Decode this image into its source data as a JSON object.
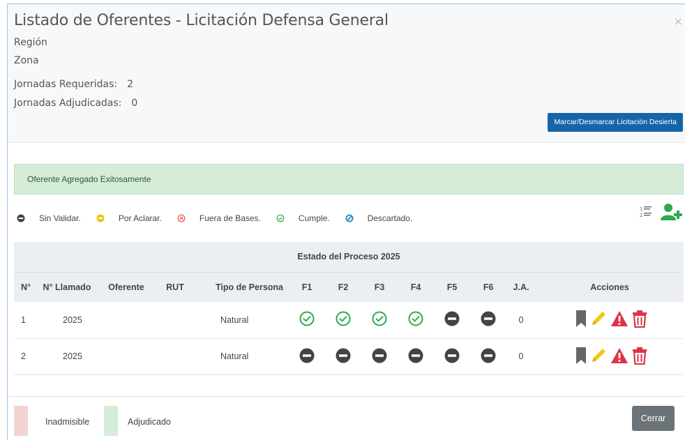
{
  "header": {
    "title": "Listado de Oferentes - Licitación Defensa General",
    "close_glyph": "×",
    "region_label": "Región",
    "zona_label": "Zona",
    "jornadas_requeridas_label": "Jornadas Requeridas:",
    "jornadas_requeridas_value": "2",
    "jornadas_adjudicadas_label": "Jornadas Adjudicadas:",
    "jornadas_adjudicadas_value": "0",
    "desierta_button": "Marcar/Desmarcar Licitación Desierta"
  },
  "alert": {
    "message": "Oferente Agregado Exitosamente"
  },
  "legend": [
    {
      "icon": "minus-circle-icon",
      "label": "Sin Validar.",
      "color": "#444444"
    },
    {
      "icon": "minus-circle-icon",
      "label": "Por Aclarar.",
      "color": "#f1c40f"
    },
    {
      "icon": "x-circle-icon",
      "label": "Fuera de Bases.",
      "color": "#e74c3c"
    },
    {
      "icon": "check-circle-icon",
      "label": "Cumple.",
      "color": "#2ea84b"
    },
    {
      "icon": "ban-icon",
      "label": "Descartado.",
      "color": "#1e88c8"
    }
  ],
  "table": {
    "group_header": "Estado del Proceso 2025",
    "columns": [
      "N°",
      "N° Llamado",
      "Oferente",
      "RUT",
      "Tipo de Persona",
      "F1",
      "F2",
      "F3",
      "F4",
      "F5",
      "F6",
      "J.A.",
      "Acciones"
    ],
    "rows": [
      {
        "n": "1",
        "llamado": "2025",
        "oferente": "",
        "rut": "",
        "tipo": "Natural",
        "f": [
          "check",
          "check",
          "check",
          "check",
          "minus",
          "minus"
        ],
        "ja": "0"
      },
      {
        "n": "2",
        "llamado": "2025",
        "oferente": "",
        "rut": "",
        "tipo": "Natural",
        "f": [
          "minus",
          "minus",
          "minus",
          "minus",
          "minus",
          "minus"
        ],
        "ja": "0"
      }
    ]
  },
  "footer": {
    "inadmisible_label": "Inadmisible",
    "adjudicado_label": "Adjudicado",
    "inadmisible_color": "#f4d3d3",
    "adjudicado_color": "#d5ecd8",
    "cerrar_button": "Cerrar"
  },
  "colors": {
    "primary_button": "#1565a8",
    "check": "#2ea84b",
    "minus": "#444444",
    "bookmark": "#666666",
    "pencil": "#f5c518",
    "warning": "#dc3545",
    "trash": "#dc3545",
    "add_user": "#2ea84b"
  }
}
